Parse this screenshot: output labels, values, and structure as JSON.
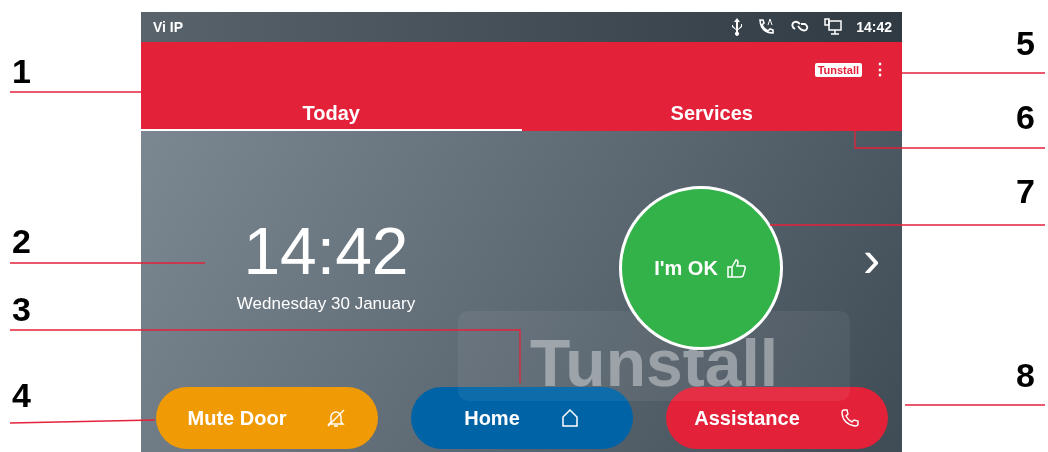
{
  "status_bar": {
    "carrier": "Vi IP",
    "time": "14:42"
  },
  "header": {
    "logo": "Tunstall",
    "menu": "⋮"
  },
  "tabs": [
    {
      "label": "Today",
      "selected": true
    },
    {
      "label": "Services",
      "selected": false
    }
  ],
  "clock": {
    "time": "14:42",
    "date": "Wednesday 30 January"
  },
  "background_logo": "Tunstall",
  "ok_button": {
    "label": "I'm OK"
  },
  "next": "›",
  "buttons": [
    {
      "label": "Mute Door",
      "kind": "mute",
      "color": "#f09a05"
    },
    {
      "label": "Home",
      "kind": "home",
      "color": "#0063a6"
    },
    {
      "label": "Assistance",
      "kind": "call",
      "color": "#e3223a"
    }
  ],
  "callouts": [
    {
      "number": "1"
    },
    {
      "number": "2"
    },
    {
      "number": "3"
    },
    {
      "number": "4"
    },
    {
      "number": "5"
    },
    {
      "number": "6"
    },
    {
      "number": "7"
    },
    {
      "number": "8"
    }
  ]
}
